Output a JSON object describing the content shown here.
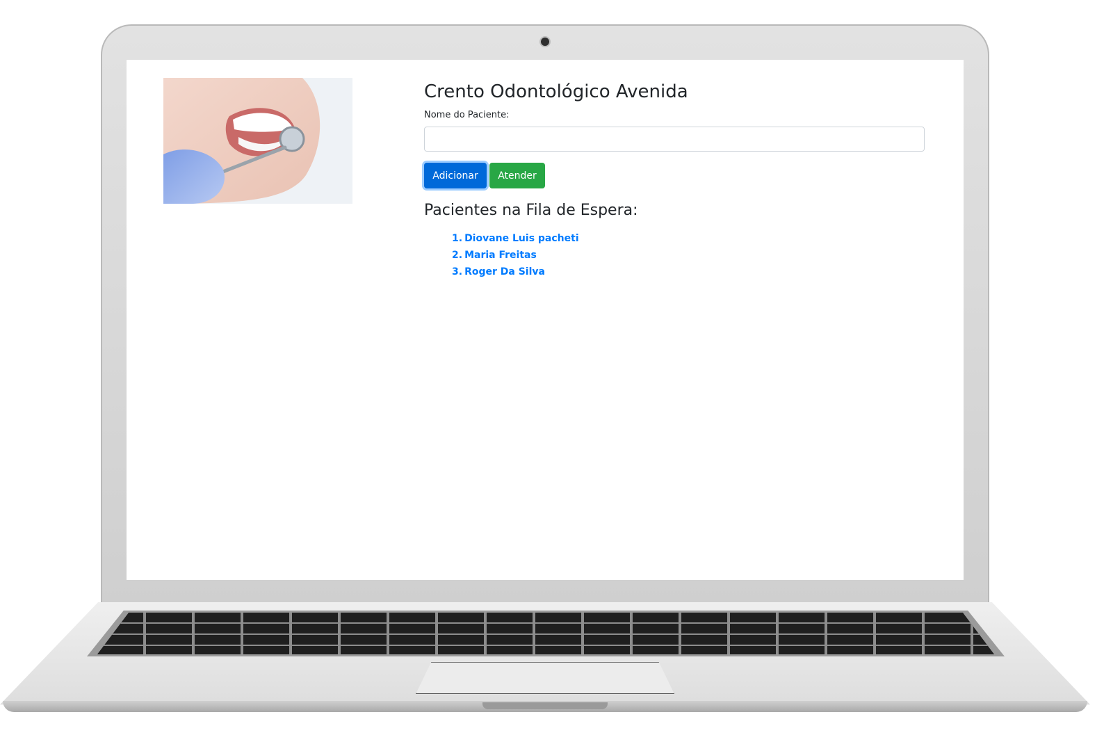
{
  "app": {
    "title": "Crento Odontológico Avenida"
  },
  "form": {
    "label": "Nome do Paciente:",
    "input_value": "",
    "input_placeholder": "",
    "add_label": "Adicionar",
    "serve_label": "Atender"
  },
  "queue": {
    "heading": "Pacientes na Fila de Espera:",
    "items": [
      {
        "number": "1.",
        "name": "Diovane Luis pacheti"
      },
      {
        "number": "2.",
        "name": "Maria Freitas"
      },
      {
        "number": "3.",
        "name": "Roger Da Silva"
      }
    ]
  },
  "colors": {
    "primary": "#0069d9",
    "success": "#28a745",
    "link": "#007bff",
    "text": "#212529"
  },
  "icons": {
    "hero": "dental-smile-image"
  }
}
